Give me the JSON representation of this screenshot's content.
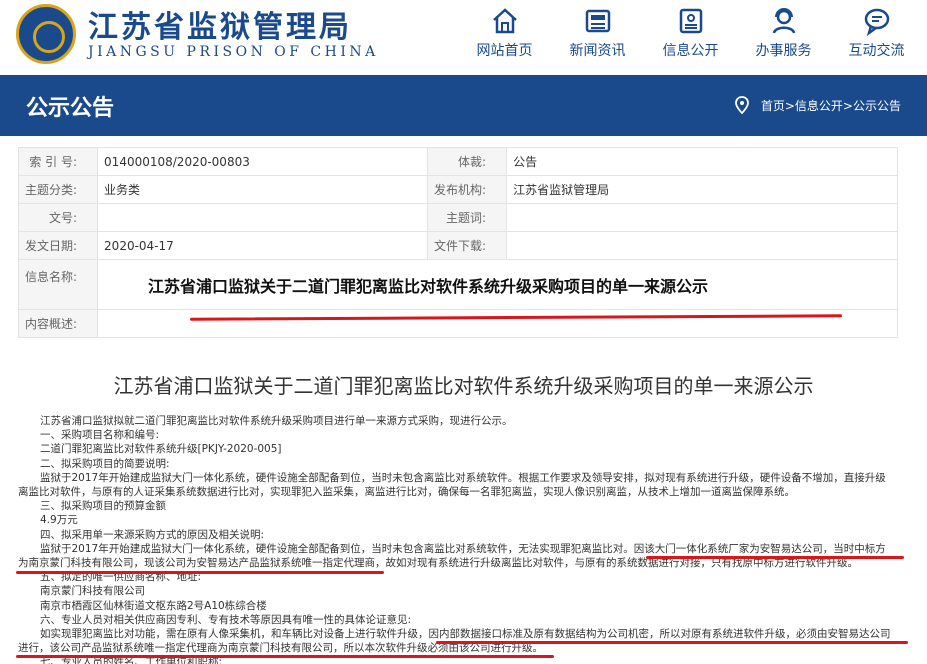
{
  "header": {
    "site_title": "江苏省监狱管理局",
    "site_subtitle": "JIANGSU PRISON OF CHINA",
    "nav": [
      {
        "label": "网站首页",
        "icon": "home-icon"
      },
      {
        "label": "新闻资讯",
        "icon": "newspaper-icon"
      },
      {
        "label": "信息公开",
        "icon": "document-icon"
      },
      {
        "label": "办事服务",
        "icon": "service-icon"
      },
      {
        "label": "互动交流",
        "icon": "chat-icon"
      }
    ]
  },
  "banner": {
    "title": "公示公告",
    "breadcrumb": "首页>信息公开>公示公告"
  },
  "info": {
    "index_label": "索 引 号:",
    "index_value": "014000108/2020-00803",
    "genre_label": "体裁:",
    "genre_value": "公告",
    "category_label": "主题分类:",
    "category_value": "业务类",
    "publisher_label": "发布机构:",
    "publisher_value": "江苏省监狱管理局",
    "doc_no_label": "文号:",
    "doc_no_value": "",
    "keywords_label": "主题词:",
    "keywords_value": "",
    "date_label": "发文日期:",
    "date_value": "2020-04-17",
    "download_label": "文件下载:",
    "download_value": "",
    "name_label": "信息名称:",
    "name_value": "江苏省浦口监狱关于二道门罪犯离监比对软件系统升级采购项目的单一来源公示",
    "summary_label": "内容概述:",
    "summary_value": ""
  },
  "article": {
    "title": "江苏省浦口监狱关于二道门罪犯离监比对软件系统升级采购项目的单一来源公示",
    "lines": [
      "江苏省浦口监狱拟就二道门罪犯离监比对软件系统升级采购项目进行单一来源方式采购，现进行公示。",
      "一、采购项目名称和编号:",
      "二道门罪犯离监比对软件系统升级[PKJY-2020-005]",
      "二、拟采购项目的简要说明:",
      "监狱于2017年开始建成监狱大门一体化系统，硬件设施全部配备到位，当时未包含离监比对系统软件。根据工作要求及领导安排，拟对现有系统进行升级，硬件设备不增加，直接升级",
      "离监比对软件，与原有的人证采集系统数据进行比对，实现罪犯入监采集，离监进行比对，确保每一名罪犯离监，实现人像识别离监，从技术上增加一道离监保障系统。",
      "三、拟采购项目的预算金额",
      "4.9万元",
      "四、拟采用单一来源采购方式的原因及相关说明:",
      "监狱于2017年开始建成监狱大门一体化系统，硬件设施全部配备到位，当时未包含离监比对系统软件，无法实现罪犯离监比对。因该大门一体化系统厂家为安智易达公司，当时中标方",
      "为南京蒙门科技有限公司，现该公司为安智易达产品监狱系统唯一指定代理商，故如对现有系统进行升级离监比对软件，与原有的系统数据进行对接，只有找原中标方进行软件升级。",
      "五、拟定的唯一供应商名称、地址:",
      "南京蒙门科技有限公司",
      "南京市栖霞区仙林街道文枢东路2号A10栋综合楼",
      "六、专业人员对相关供应商因专利、专有技术等原因具有唯一性的具体论证意见:",
      "如实现罪犯离监比对功能，需在原有人像采集机，和车辆比对设备上进行软件升级，因内部数据接口标准及原有数据结构为公司机密，所以对原有系统进软件升级，必须由安智易达公司",
      "进行，该公司产品监狱系统唯一指定代理商为南京蒙门科技有限公司，所以本次软件升级必须由该公司进行升级。",
      "七、专业人员的姓名、工作单位和职称:"
    ]
  },
  "colors": {
    "brand": "#1a4a8c",
    "accent_gold": "#d9a419",
    "annotation_red": "#d9161b"
  }
}
